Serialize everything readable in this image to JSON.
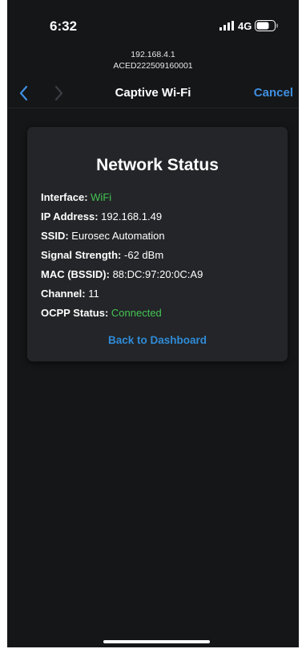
{
  "status_bar": {
    "time": "6:32",
    "network": "4G",
    "icons": [
      "signal-icon",
      "battery-icon"
    ]
  },
  "address": {
    "ip": "192.168.4.1",
    "device_id": "ACED222509160001"
  },
  "nav": {
    "title": "Captive Wi-Fi",
    "cancel_label": "Cancel",
    "icons": [
      "chevron-left-icon",
      "chevron-right-icon"
    ]
  },
  "card": {
    "title": "Network Status",
    "rows": [
      {
        "label": "Interface:",
        "value": "WiFi",
        "color": "#44c553"
      },
      {
        "label": "IP Address:",
        "value": "192.168.1.49"
      },
      {
        "label": "SSID:",
        "value": "Eurosec Automation"
      },
      {
        "label": "Signal Strength:",
        "value": "-62 dBm"
      },
      {
        "label": "MAC (BSSID):",
        "value": "88:DC:97:20:0C:A9"
      },
      {
        "label": "Channel:",
        "value": "11"
      },
      {
        "label": "OCPP Status:",
        "value": "Connected",
        "color": "#44c553"
      }
    ],
    "link_label": "Back to Dashboard"
  },
  "colors": {
    "background": "#151618",
    "card": "#232528",
    "accent": "#2f8bd8",
    "success": "#44c553"
  }
}
